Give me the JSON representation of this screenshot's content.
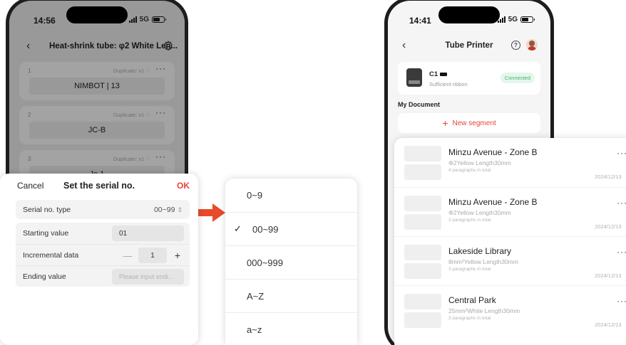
{
  "left_phone": {
    "time": "14:56",
    "network": "5G",
    "title": "Heat-shrink tube: φ2 White Len...",
    "segments": [
      {
        "number": "1",
        "duplicate": "Duplicate: x1 ♢",
        "value": "NIMBOT | 13"
      },
      {
        "number": "2",
        "duplicate": "Duplicate: x1 ♢",
        "value": "JC-B"
      },
      {
        "number": "3",
        "duplicate": "Duplicate: x1 ♢",
        "value": "Jc-1"
      }
    ]
  },
  "serial_dialog": {
    "cancel": "Cancel",
    "title": "Set the serial no.",
    "ok": "OK",
    "type_label": "Serial no. type",
    "type_value": "00~99",
    "starting_label": "Starting value",
    "starting_value": "01",
    "increment_label": "Incremental data",
    "increment_value": "1",
    "ending_label": "Ending value",
    "ending_placeholder": "Please input endi..."
  },
  "type_menu": {
    "options": [
      "0~9",
      "00~99",
      "000~999",
      "A~Z",
      "a~z"
    ],
    "selected_index": 1
  },
  "right_phone": {
    "time": "14:41",
    "network": "5G",
    "title": "Tube Printer",
    "device_name": "C1",
    "device_status": "Sufficient ribbon",
    "connection": "Connected",
    "section_label": "My Document",
    "new_segment": "New segment"
  },
  "documents": [
    {
      "title": "Minzu Avenue - Zone B",
      "spec": "Φ2Yellow Length30mm",
      "paragraphs": "4 paragraphs in total",
      "date": "2024/12/13"
    },
    {
      "title": "Minzu Avenue - Zone B",
      "spec": "Φ2Yellow Length30mm",
      "paragraphs": "3 paragraphs in total",
      "date": "2024/12/13"
    },
    {
      "title": "Lakeside Library",
      "spec": "8mm²Yellow Length30mm",
      "paragraphs": "3 paragraphs in total",
      "date": "2024/12/13"
    },
    {
      "title": "Central Park",
      "spec": "25mm²White Length30mm",
      "paragraphs": "3 paragraphs in total",
      "date": "2024/12/13"
    }
  ],
  "colors": {
    "accent": "#e8423a",
    "connected": "#43b36b"
  }
}
